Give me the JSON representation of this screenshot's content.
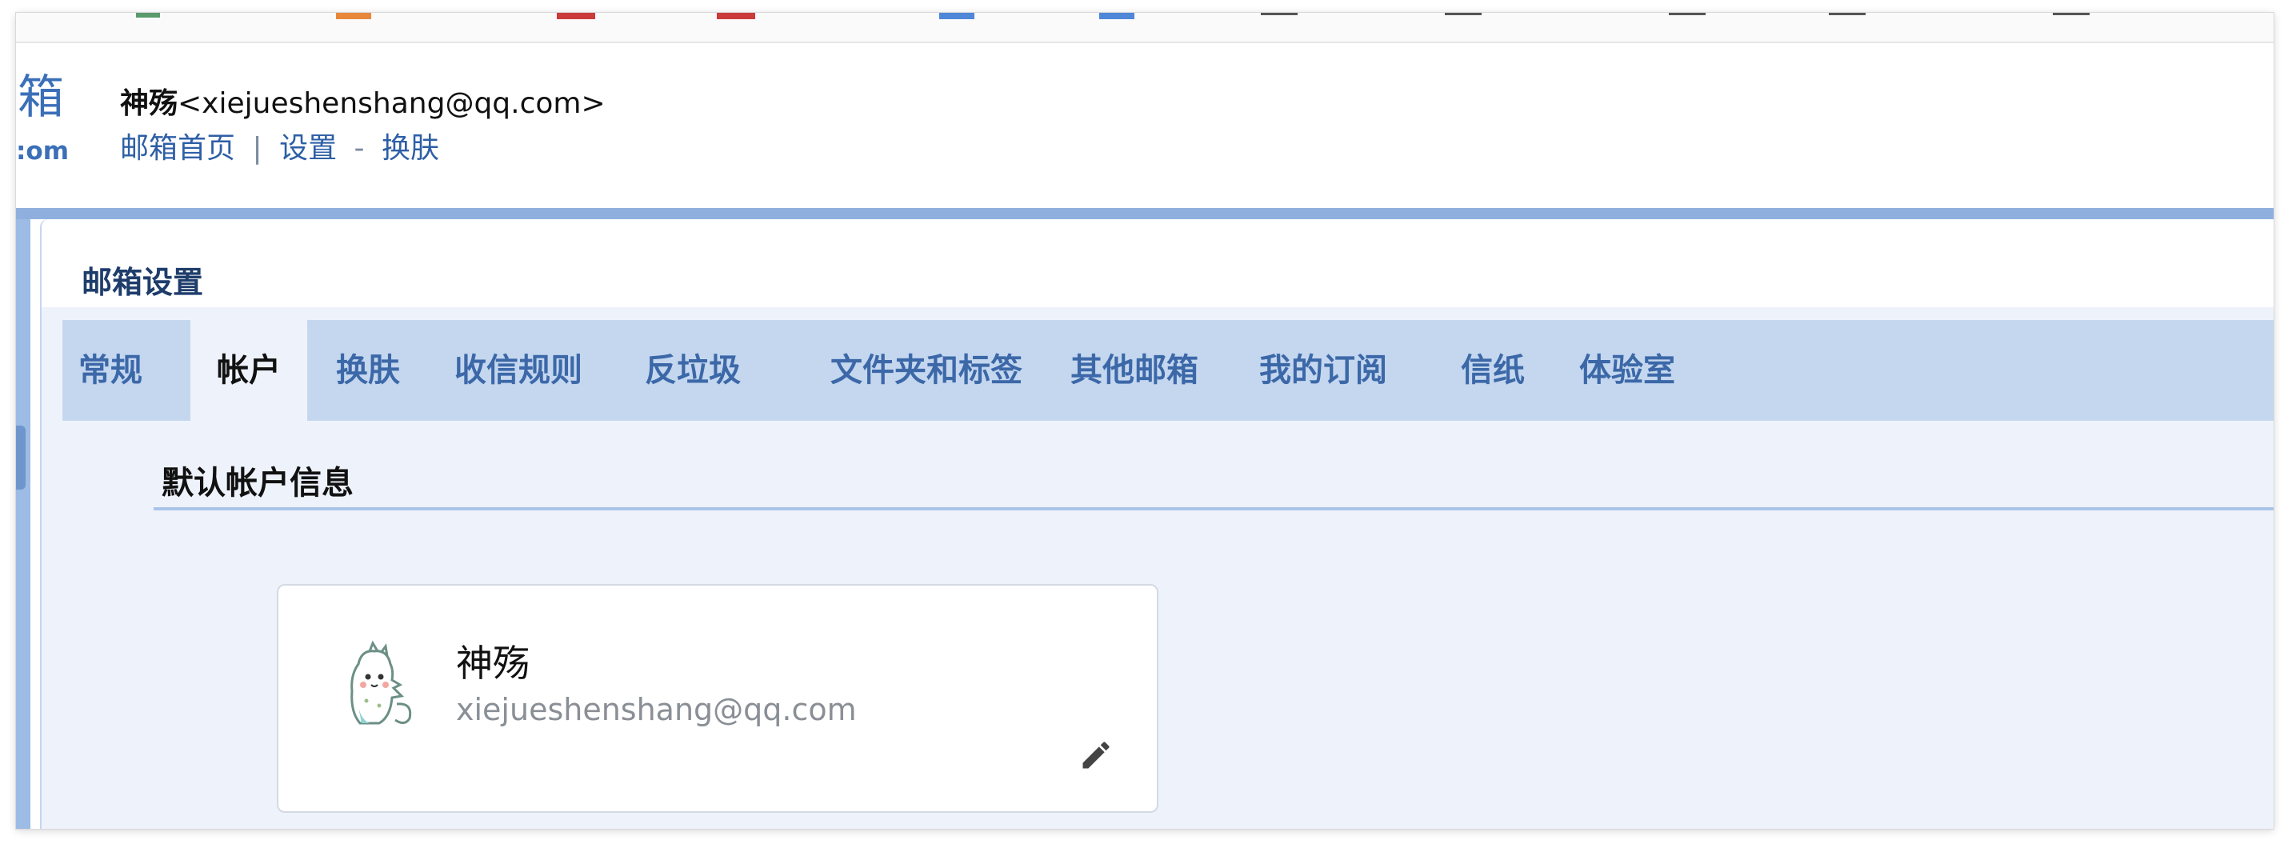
{
  "header": {
    "logo_big": "箱",
    "logo_small": ":om",
    "user_name": "神殇",
    "user_email_bracketed": "<xiejueshenshang@qq.com>",
    "links": [
      "邮箱首页",
      "|",
      "设置",
      "-",
      "换肤"
    ]
  },
  "panel": {
    "title": "邮箱设置",
    "tabs": [
      "常规",
      "帐户",
      "换肤",
      "收信规则",
      "反垃圾",
      "文件夹和标签",
      "其他邮箱",
      "我的订阅",
      "信纸",
      "体验室"
    ],
    "active_tab": "帐户"
  },
  "section": {
    "title": "默认帐户信息"
  },
  "account_card": {
    "name": "神殇",
    "email": "xiejueshenshang@qq.com",
    "avatar_icon": "dinosaur-avatar-icon",
    "edit_icon": "pencil-icon"
  },
  "colors": {
    "link_blue": "#2e5fa6",
    "tab_bar": "#c4d7ef",
    "panel_bg": "#eef3fb",
    "band": "#8fb0de"
  }
}
